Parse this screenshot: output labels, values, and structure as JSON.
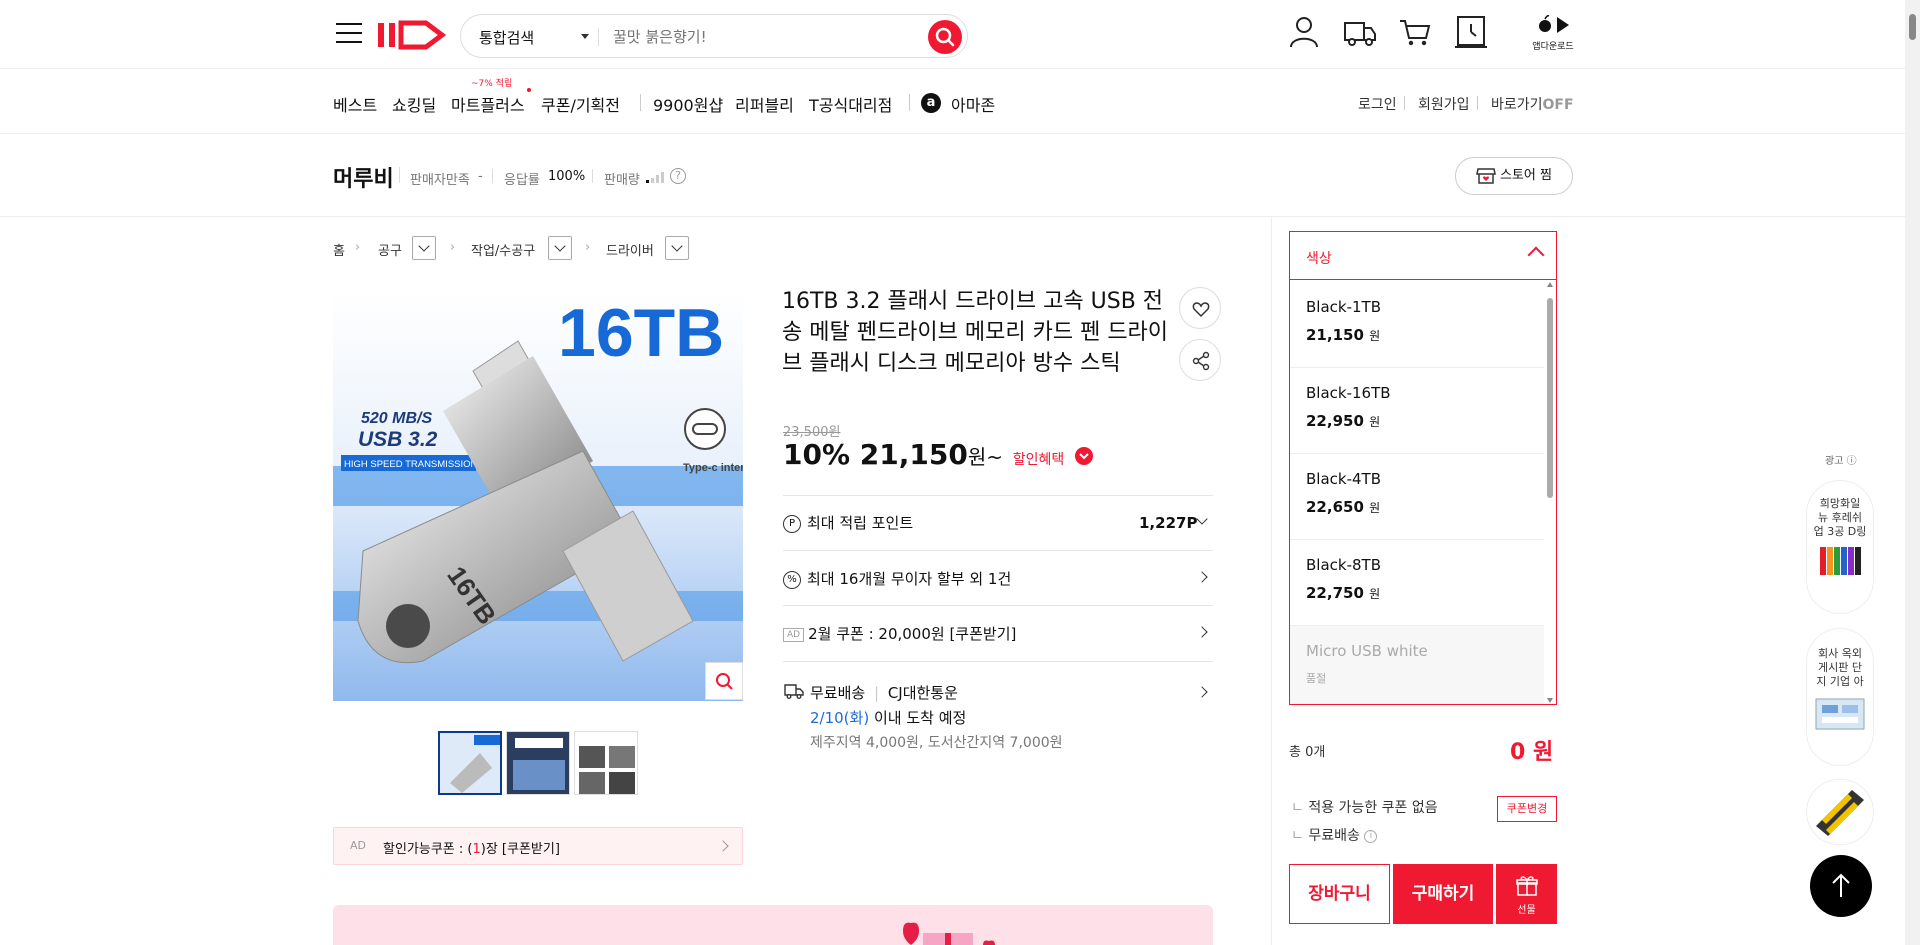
{
  "header": {
    "search_category": "통합검색",
    "search_placeholder": "꿀맛 붉은향기!",
    "app_download_label": "앱다운로드"
  },
  "nav": {
    "items": [
      "베스트",
      "쇼킹딜",
      "마트플러스",
      "쿠폰/기획전",
      "9900원샵",
      "리퍼블리",
      "T공식대리점",
      "아마존"
    ],
    "mart_badge": "~7% 적립",
    "amazon_logo": "a",
    "right_links": [
      "로그인",
      "회원가입"
    ],
    "shortcut_label": "바로가기",
    "shortcut_state": "OFF"
  },
  "seller": {
    "name": "머루비",
    "satisfaction_label": "판매자만족",
    "satisfaction_value": "-",
    "response_label": "응답률",
    "response_value": "100%",
    "sales_label": "판매량",
    "help": "?",
    "store_button": "스토어 찜"
  },
  "breadcrumb": [
    "홈",
    "공구",
    "작업/수공구",
    "드라이버"
  ],
  "product": {
    "title": "16TB 3.2 플래시 드라이브 고속 USB 전송 메탈 펜드라이브 메모리 카드 펜 드라이브 플래시 디스크 메모리아 방수 스틱",
    "image_text": {
      "capacity": "16TB",
      "speed": "520 MB/S",
      "usb": "USB 3.2",
      "transmission": "HIGH SPEED TRANSMISSION",
      "interface": "Type-c interface"
    },
    "original_price": "23,500원",
    "discount": "10%",
    "price": "21,150",
    "price_unit": "원~",
    "benefit_label": "할인혜택",
    "points_label": "최대 적립 포인트",
    "points_value": "1,227P",
    "installment": "최대 16개월 무이자 할부 외 1건",
    "ad_badge": "AD",
    "coupon_text": "2월 쿠폰 : 20,000원 [쿠폰받기]",
    "shipping_free": "무료배송",
    "shipping_carrier": "CJ대한통운",
    "arrival_date": "2/10(화)",
    "arrival_text": "이내 도착 예정",
    "shipping_extra": "제주지역 4,000원, 도서산간지역 7,000원",
    "coupon_bar_ad": "AD",
    "coupon_bar_prefix": "할인가능쿠폰 : (",
    "coupon_bar_count": "1",
    "coupon_bar_suffix": ")장 [쿠폰받기]"
  },
  "options": {
    "header": "색상",
    "items": [
      {
        "name": "Black-1TB",
        "price": "21,150",
        "unit": "원"
      },
      {
        "name": "Black-16TB",
        "price": "22,950",
        "unit": "원"
      },
      {
        "name": "Black-4TB",
        "price": "22,650",
        "unit": "원"
      },
      {
        "name": "Black-8TB",
        "price": "22,750",
        "unit": "원"
      },
      {
        "name": "Micro USB white",
        "price": "품절",
        "unit": ""
      }
    ]
  },
  "order": {
    "total_label": "총 0개",
    "total_price": "0 원",
    "coupon_none": "적용 가능한 쿠폰 없음",
    "coupon_change": "쿠폰변경",
    "free_shipping": "무료배송",
    "cart": "장바구니",
    "buy": "구매하기",
    "gift": "선물"
  },
  "side_ads": {
    "label": "광고",
    "card1": "희망화일 뉴 후레쉬 업 3공 D링",
    "card2": "회사 옥외 게시판 단지 기업 아"
  },
  "colors": {
    "brand": "#f01932",
    "link_blue": "#1a6dd8"
  }
}
